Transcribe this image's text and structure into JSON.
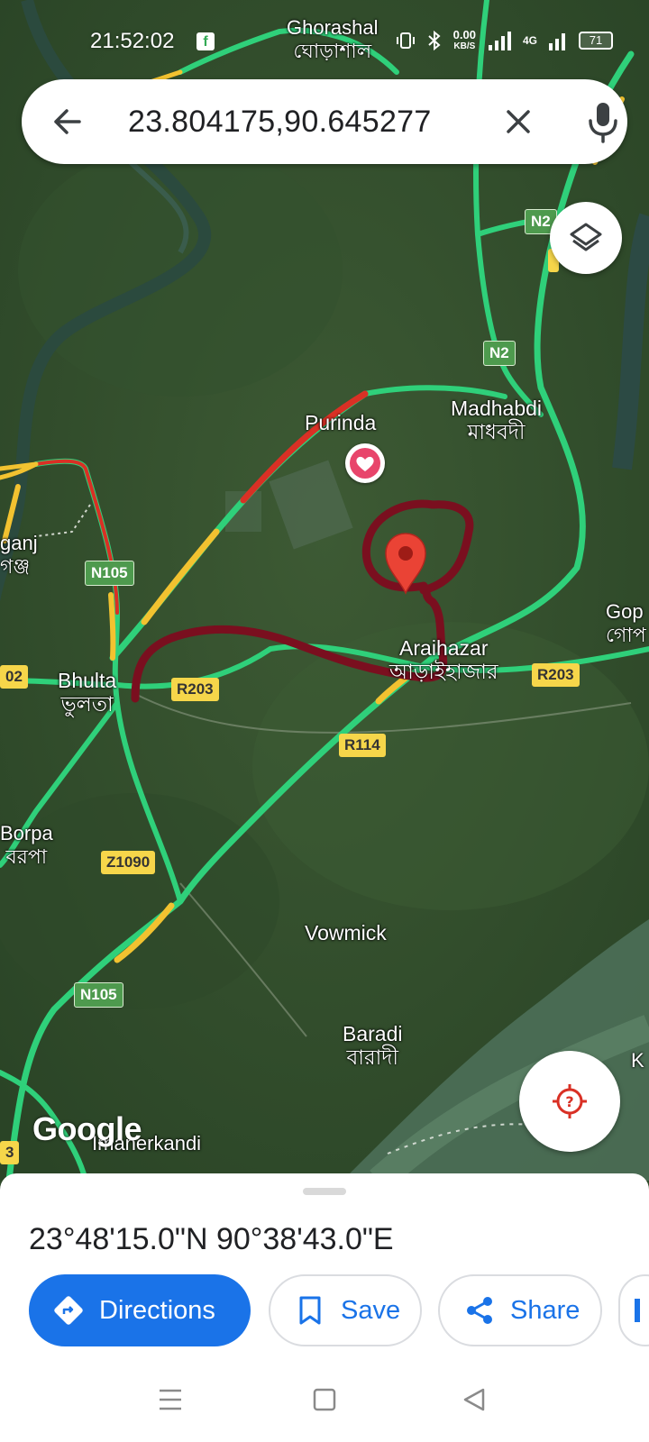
{
  "status_bar": {
    "time": "21:52:02",
    "net_speed_value": "0.00",
    "net_speed_unit": "KB/S",
    "network": "4G",
    "battery": "71"
  },
  "search": {
    "query": "23.804175,90.645277"
  },
  "map_labels": {
    "ghorashal_en": "Ghorashal",
    "ghorashal_bn": "ঘোড়াশাল",
    "purinda": "Purinda",
    "madhabdi_en": "Madhabdi",
    "madhabdi_bn": "মাধবদী",
    "ganj_en": "ganj",
    "ganj_bn": "গঞ্জ",
    "araihazar_en": "Araihazar",
    "araihazar_bn": "আড়াইহাজার",
    "gop_en": "Gop",
    "gop_bn": "গোপ",
    "bhulta_en": "Bhulta",
    "bhulta_bn": "ভুলতা",
    "borpa_en": "Borpa",
    "borpa_bn": "বরপা",
    "vowmick": "Vowmick",
    "baradi_en": "Baradi",
    "baradi_bn": "বারাদী",
    "imanerkandi": "Imanerkandi",
    "k_edge": "K",
    "left_02": "02",
    "left_3": "3"
  },
  "road_shields": {
    "n2_top": "N2",
    "n2_mid": "N2",
    "n105_upper": "N105",
    "n105_lower": "N105",
    "r203_left": "R203",
    "r203_right": "R203",
    "r114": "R114",
    "z1090": "Z1090"
  },
  "attribution": "Google",
  "place_sheet": {
    "coordinates": "23°48'15.0\"N 90°38'43.0\"E",
    "directions_label": "Directions",
    "save_label": "Save",
    "share_label": "Share"
  },
  "colors": {
    "accent": "#1a73e8",
    "pin": "#ea4335",
    "annotation": "#7a0f1f",
    "road_green": "#2fd07a",
    "road_yellow": "#f2c230",
    "road_red": "#d93025"
  },
  "icons": {
    "back": "arrow-left-icon",
    "clear": "close-icon",
    "mic": "microphone-icon",
    "layers": "layers-icon",
    "locate": "my-location-icon",
    "saved_place": "heart-icon",
    "directions": "directions-icon",
    "save": "bookmark-icon",
    "share": "share-icon"
  }
}
